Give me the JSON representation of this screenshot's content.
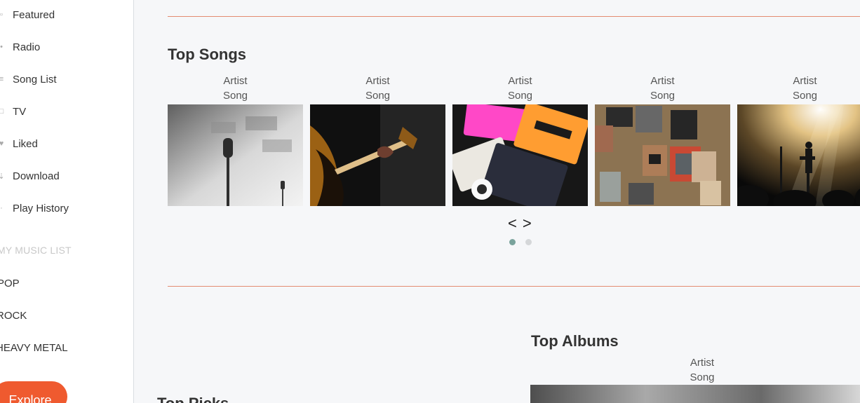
{
  "sidebar": {
    "nav": [
      {
        "label": "Featured",
        "icon": "featured-icon"
      },
      {
        "label": "Radio",
        "icon": "radio-icon"
      },
      {
        "label": "Song List",
        "icon": "list-icon"
      },
      {
        "label": "TV",
        "icon": "tv-icon"
      },
      {
        "label": "Liked",
        "icon": "heart-icon"
      },
      {
        "label": "Download",
        "icon": "download-icon"
      },
      {
        "label": "Play History",
        "icon": "history-icon"
      }
    ],
    "section_title": "MY MUSIC LIST",
    "playlists": [
      "POP",
      "ROCK",
      "HEAVY METAL"
    ],
    "explore_label": "Explore"
  },
  "main": {
    "top_songs": {
      "heading": "Top Songs",
      "cards": [
        {
          "artist": "Artist",
          "song": "Song"
        },
        {
          "artist": "Artist",
          "song": "Song"
        },
        {
          "artist": "Artist",
          "song": "Song"
        },
        {
          "artist": "Artist",
          "song": "Song"
        },
        {
          "artist": "Artist",
          "song": "Song"
        }
      ],
      "prev_icon": "chevron-left-icon",
      "next_icon": "chevron-right-icon",
      "prev_label": "<",
      "next_label": ">",
      "pages": 2,
      "active_page": 1
    },
    "top_albums": {
      "heading": "Top Albums",
      "artist": "Artist",
      "song": "Song"
    },
    "top_picks": {
      "heading": "Top Picks"
    }
  },
  "colors": {
    "accent": "#ef5a2f",
    "divider": "#e38b71",
    "dot_active": "#7aa39c",
    "dot_inactive": "#d5d7d9"
  }
}
